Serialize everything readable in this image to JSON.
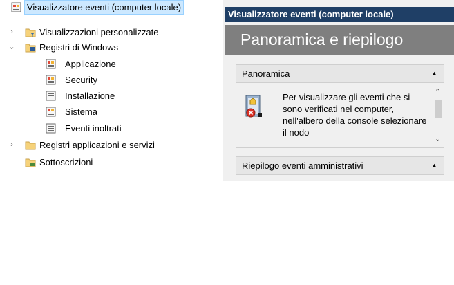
{
  "tree": {
    "root": {
      "label": "Visualizzatore eventi (computer locale)",
      "icon": "event-viewer-icon"
    },
    "items": [
      {
        "label": "Visualizzazioni personalizzate",
        "icon": "folder-filter-icon",
        "expander": "›"
      },
      {
        "label": "Registri di Windows",
        "icon": "folder-logs-icon",
        "expander": "⌄"
      },
      {
        "label": "Applicazione",
        "icon": "log-app-icon"
      },
      {
        "label": "Security",
        "icon": "log-security-icon"
      },
      {
        "label": "Installazione",
        "icon": "log-setup-icon"
      },
      {
        "label": "Sistema",
        "icon": "log-system-icon"
      },
      {
        "label": "Eventi inoltrati",
        "icon": "log-forwarded-icon"
      },
      {
        "label": "Registri applicazioni e servizi",
        "icon": "folder-icon",
        "expander": "›"
      },
      {
        "label": "Sottoscrizioni",
        "icon": "subscriptions-icon"
      }
    ]
  },
  "right": {
    "header": "Visualizzatore eventi (computer locale)",
    "title": "Panoramica e riepilogo",
    "overview": {
      "heading": "Panoramica",
      "caret": "▲",
      "text": "Per visualizzare gli eventi che si sono verificati nel computer, nell'albero della console selezionare il nodo"
    },
    "summary": {
      "heading": "Riepilogo eventi amministrativi",
      "caret": "▲"
    },
    "scroll": {
      "up": "⌃",
      "down": "⌄"
    }
  },
  "colors": {
    "header": "#1f3f66",
    "title_band": "#7f7f7f",
    "selection": "#cce8ff"
  }
}
